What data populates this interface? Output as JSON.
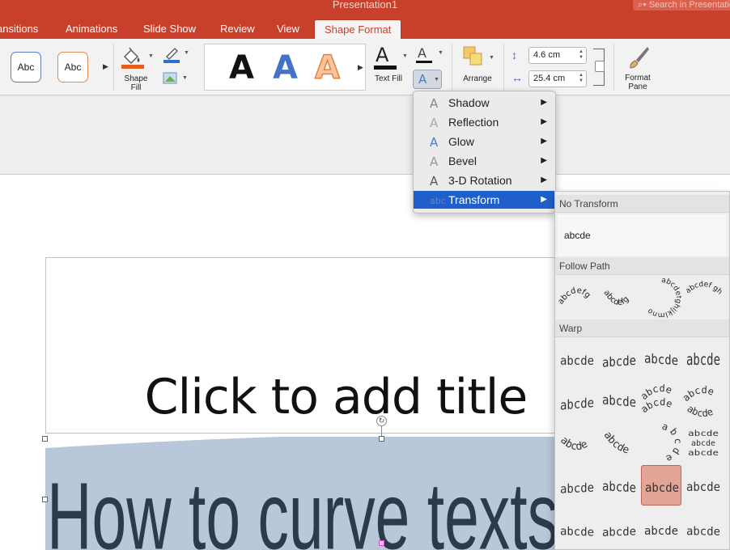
{
  "window": {
    "title": "Presentation1",
    "search_placeholder": "Search in Presentation"
  },
  "tabs": [
    {
      "label": "ansitions"
    },
    {
      "label": "Animations"
    },
    {
      "label": "Slide Show"
    },
    {
      "label": "Review"
    },
    {
      "label": "View"
    },
    {
      "label": "Shape Format",
      "active": true
    }
  ],
  "ribbon": {
    "shape_style_1": "Abc",
    "shape_style_2": "Abc",
    "shape_fill_label": "Shape\nFill",
    "wordart_letter": "A",
    "text_fill_label": "Text Fill",
    "text_effects_letter": "A",
    "arrange_label": "Arrange",
    "height_value": "4.6 cm",
    "width_value": "25.4 cm",
    "format_pane_label": "Format\nPane",
    "colors": {
      "accent": "#c8402c",
      "shape_fill": "#e35d1e",
      "line_blue": "#2f6fd0",
      "wordart_blue": "#4472c4",
      "wordart_orange": "#ed7d31"
    }
  },
  "text_effects_menu": {
    "items": [
      {
        "label": "Shadow",
        "icon": "text-shadow-icon"
      },
      {
        "label": "Reflection",
        "icon": "text-reflection-icon"
      },
      {
        "label": "Glow",
        "icon": "text-glow-icon"
      },
      {
        "label": "Bevel",
        "icon": "text-bevel-icon"
      },
      {
        "label": "3-D Rotation",
        "icon": "text-3d-rotation-icon"
      },
      {
        "label": "Transform",
        "icon": "text-transform-icon",
        "highlighted": true
      }
    ]
  },
  "transform_panel": {
    "no_transform_header": "No Transform",
    "no_transform_sample": "abcde",
    "follow_path_header": "Follow Path",
    "warp_header": "Warp",
    "follow_path_samples": [
      "abcdefg",
      "abcdefg",
      "abcdefghijklmno",
      "abcdef ghij klmnop"
    ],
    "warp_sample": "abcde",
    "warp_selected_index": 14
  },
  "slide": {
    "title_placeholder": "Click to add title",
    "curved_text": "How to curve texts"
  }
}
